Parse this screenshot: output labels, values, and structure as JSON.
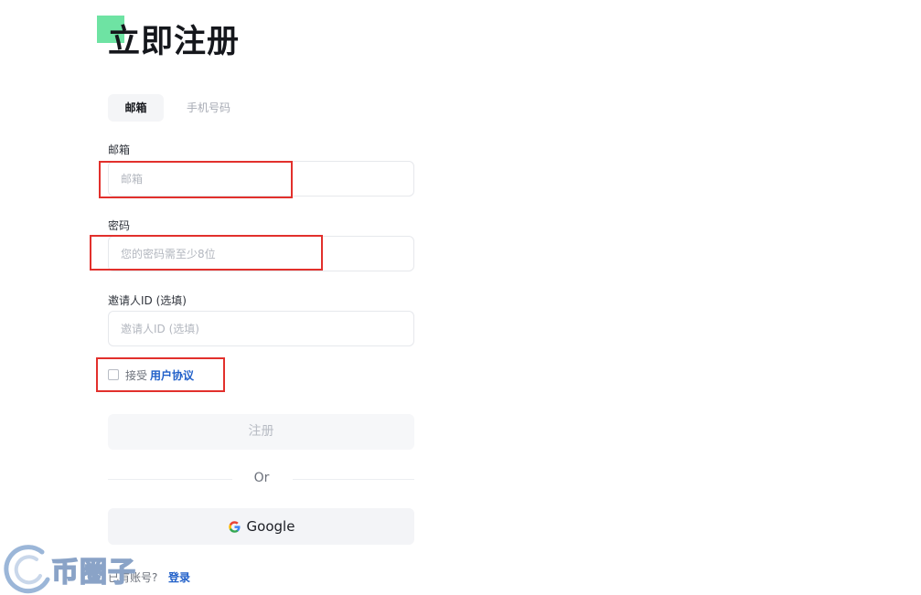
{
  "page": {
    "title": "立即注册"
  },
  "tabs": [
    {
      "label": "邮箱",
      "active": true
    },
    {
      "label": "手机号码",
      "active": false
    }
  ],
  "form": {
    "email": {
      "label": "邮箱",
      "placeholder": "邮箱",
      "value": ""
    },
    "password": {
      "label": "密码",
      "placeholder": "您的密码需至少8位",
      "value": ""
    },
    "referral": {
      "label": "邀请人ID (选填)",
      "placeholder": "邀请人ID (选填)",
      "value": ""
    },
    "agree": {
      "checked": false,
      "text": "接受",
      "link": "用户协议"
    },
    "submit_label": "注册"
  },
  "divider_label": "Or",
  "google_label": "Google",
  "footer": {
    "prompt": "已有账号?",
    "login_label": "登录"
  },
  "watermark": "币圈子",
  "colors": {
    "accent_green": "#6ee3a3",
    "highlight_red": "#e2302c",
    "link_blue": "#2160c9"
  }
}
